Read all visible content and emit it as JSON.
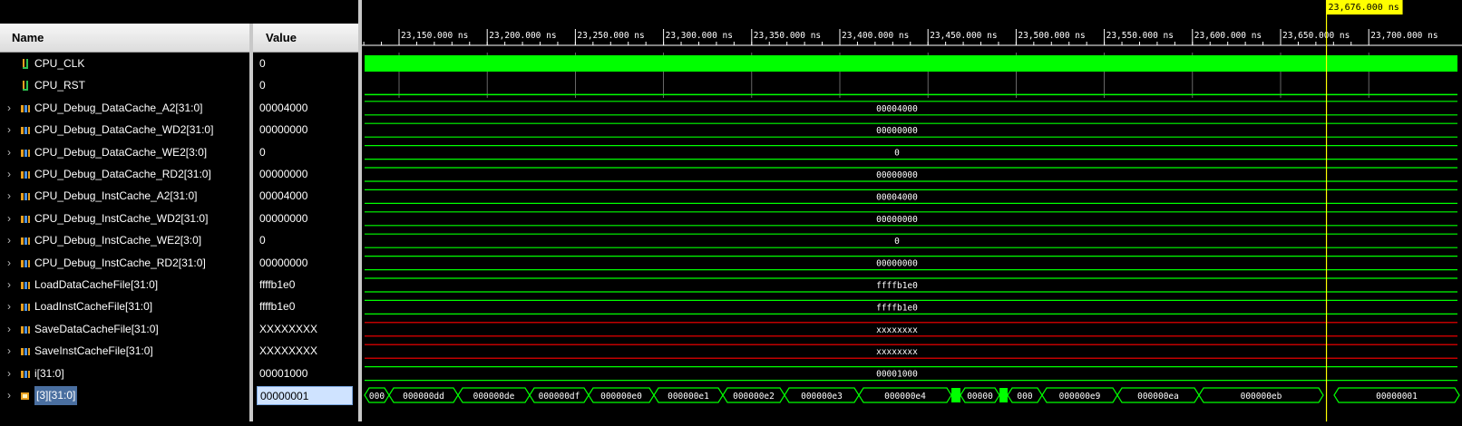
{
  "header": {
    "name_label": "Name",
    "value_label": "Value"
  },
  "signals": [
    {
      "name": "CPU_CLK",
      "value": "0",
      "kind": "bit",
      "expandable": false
    },
    {
      "name": "CPU_RST",
      "value": "0",
      "kind": "bit",
      "expandable": false
    },
    {
      "name": "CPU_Debug_DataCache_A2[31:0]",
      "value": "00004000",
      "kind": "bus",
      "expandable": true
    },
    {
      "name": "CPU_Debug_DataCache_WD2[31:0]",
      "value": "00000000",
      "kind": "bus",
      "expandable": true
    },
    {
      "name": "CPU_Debug_DataCache_WE2[3:0]",
      "value": "0",
      "kind": "bus",
      "expandable": true
    },
    {
      "name": "CPU_Debug_DataCache_RD2[31:0]",
      "value": "00000000",
      "kind": "bus",
      "expandable": true
    },
    {
      "name": "CPU_Debug_InstCache_A2[31:0]",
      "value": "00004000",
      "kind": "bus",
      "expandable": true
    },
    {
      "name": "CPU_Debug_InstCache_WD2[31:0]",
      "value": "00000000",
      "kind": "bus",
      "expandable": true
    },
    {
      "name": "CPU_Debug_InstCache_WE2[3:0]",
      "value": "0",
      "kind": "bus",
      "expandable": true
    },
    {
      "name": "CPU_Debug_InstCache_RD2[31:0]",
      "value": "00000000",
      "kind": "bus",
      "expandable": true
    },
    {
      "name": "LoadDataCacheFile[31:0]",
      "value": "ffffb1e0",
      "kind": "bus",
      "expandable": true
    },
    {
      "name": "LoadInstCacheFile[31:0]",
      "value": "ffffb1e0",
      "kind": "bus",
      "expandable": true
    },
    {
      "name": "SaveDataCacheFile[31:0]",
      "value": "XXXXXXXX",
      "kind": "bus",
      "expandable": true
    },
    {
      "name": "SaveInstCacheFile[31:0]",
      "value": "XXXXXXXX",
      "kind": "bus",
      "expandable": true
    },
    {
      "name": "i[31:0]",
      "value": "00001000",
      "kind": "bus",
      "expandable": true
    },
    {
      "name": "[3][31:0]",
      "value": "00000001",
      "kind": "array",
      "expandable": true,
      "selected": true
    }
  ],
  "wave_bus_labels": [
    "00004000",
    "00000000",
    "0",
    "00000000",
    "00004000",
    "00000000",
    "0",
    "00000000",
    "ffffb1e0",
    "ffffb1e0",
    "XXXXXXXX",
    "XXXXXXXX",
    "00001000"
  ],
  "timeline": {
    "unit": "ns",
    "ticks": [
      "23,150.000 ns",
      "23,200.000 ns",
      "23,250.000 ns",
      "23,300.000 ns",
      "23,350.000 ns",
      "23,400.000 ns",
      "23,450.000 ns",
      "23,500.000 ns",
      "23,550.000 ns",
      "23,600.000 ns",
      "23,650.000 ns",
      "23,700.000 ns"
    ],
    "cursor_label": "23,676.000 ns"
  },
  "last_row_segments": [
    "000",
    "000000dd",
    "000000de",
    "000000df",
    "000000e0",
    "000000e1",
    "000000e2",
    "000000e3",
    "000000e4",
    "00000",
    "000",
    "000000e9",
    "000000ea",
    "000000eb",
    "00000001"
  ],
  "colors": {
    "wave_green": "#00ff00",
    "x_red": "#ff0000",
    "cursor_yellow": "#ffff00"
  }
}
